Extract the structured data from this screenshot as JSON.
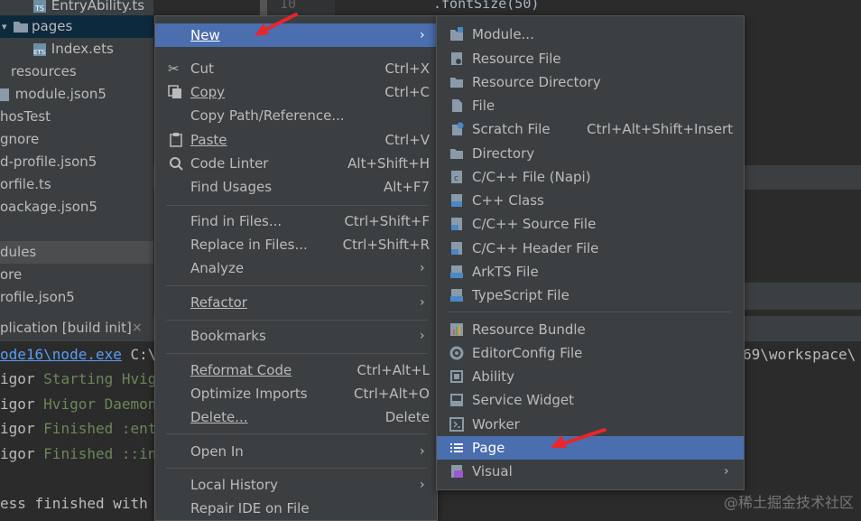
{
  "tree": {
    "items": [
      {
        "label": "EntryAbility.ts",
        "icon": "ts-file-icon"
      },
      {
        "label": "pages",
        "icon": "folder-icon"
      },
      {
        "label": "Index.ets",
        "icon": "ets-file-icon"
      },
      {
        "label": "resources",
        "icon": "folder-icon"
      },
      {
        "label": "module.json5",
        "icon": "json-file-icon"
      },
      {
        "label": "hosTest",
        "icon": ""
      },
      {
        "label": "gnore",
        "icon": ""
      },
      {
        "label": "d-profile.json5",
        "icon": ""
      },
      {
        "label": "orfile.ts",
        "icon": ""
      },
      {
        "label": "oackage.json5",
        "icon": ""
      },
      {
        "label": "dules",
        "icon": ""
      },
      {
        "label": "ore",
        "icon": ""
      },
      {
        "label": "rofile.json5",
        "icon": ""
      }
    ]
  },
  "editor": {
    "line_number": "10",
    "code": ".fontSize(50)"
  },
  "run": {
    "title": "plication [build init]",
    "close": "×"
  },
  "terminal": {
    "line1_link": "ode16\\node.exe",
    "line1_rest": " C:\\",
    "line1_right": "69\\workspace\\",
    "line2_w": "igor ",
    "line2_g": "Starting Hvig",
    "line3_w": "igor ",
    "line3_g": "Hvigor Daemon",
    "line4_w": "igor ",
    "line4_g": "Finished :ent",
    "line5_w": "igor ",
    "line5_g": "Finished ::in",
    "line6": "ess finished with"
  },
  "context_menu": {
    "new": "New",
    "cut": "Cut",
    "cut_sc": "Ctrl+X",
    "copy": "Copy",
    "copy_sc": "Ctrl+C",
    "copy_path": "Copy Path/Reference...",
    "paste": "Paste",
    "paste_sc": "Ctrl+V",
    "code_linter": "Code Linter",
    "code_linter_sc": "Alt+Shift+H",
    "find_usages": "Find Usages",
    "find_usages_sc": "Alt+F7",
    "find_in_files": "Find in Files...",
    "find_in_files_sc": "Ctrl+Shift+F",
    "replace_in_files": "Replace in Files...",
    "replace_in_files_sc": "Ctrl+Shift+R",
    "analyze": "Analyze",
    "refactor": "Refactor",
    "bookmarks": "Bookmarks",
    "reformat_code": "Reformat Code",
    "reformat_code_sc": "Ctrl+Alt+L",
    "optimize_imports": "Optimize Imports",
    "optimize_imports_sc": "Ctrl+Alt+O",
    "delete": "Delete...",
    "delete_sc": "Delete",
    "open_in": "Open In",
    "local_history": "Local History",
    "repair_ide": "Repair IDE on File"
  },
  "submenu": {
    "module": "Module...",
    "resource_file": "Resource File",
    "resource_directory": "Resource Directory",
    "file": "File",
    "scratch_file": "Scratch File",
    "scratch_file_sc": "Ctrl+Alt+Shift+Insert",
    "directory": "Directory",
    "cpp_napi": "C/C++ File (Napi)",
    "cpp_class": "C++ Class",
    "cpp_source": "C/C++ Source File",
    "cpp_header": "C/C++ Header File",
    "arkts_file": "ArkTS File",
    "typescript_file": "TypeScript File",
    "resource_bundle": "Resource Bundle",
    "editorconfig": "EditorConfig File",
    "ability": "Ability",
    "service_widget": "Service Widget",
    "worker": "Worker",
    "page": "Page",
    "visual": "Visual"
  },
  "watermark": "@稀土掘金技术社区",
  "colors": {
    "menu_bg": "#3c3f41",
    "selection": "#4b6eaf",
    "annotation_arrow": "#e8262b"
  }
}
